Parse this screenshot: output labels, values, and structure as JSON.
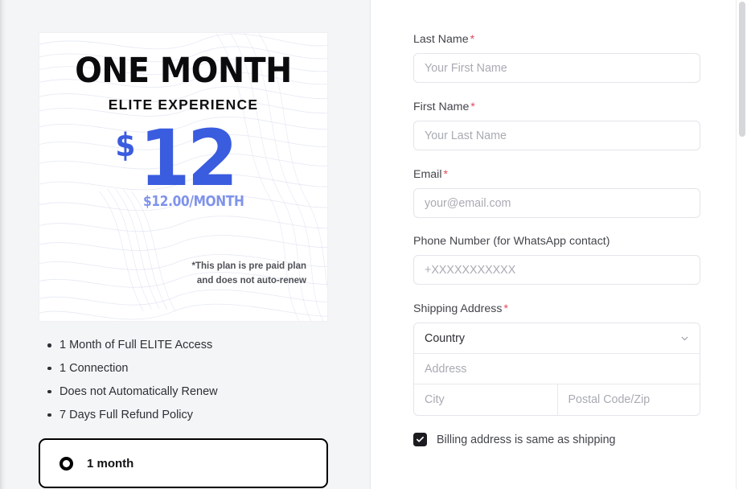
{
  "plan_card": {
    "title": "ONE MONTH",
    "subtitle": "ELITE EXPERIENCE",
    "currency_symbol": "$",
    "price_amount": "12",
    "price_per_month": "$12.00/MONTH",
    "fineprint_line1": "*This plan is pre paid plan",
    "fineprint_line2": "and does not auto-renew",
    "accent_color": "#3a5cdf",
    "accent_light_color": "#7f93ea"
  },
  "features": [
    "1 Month of Full ELITE Access",
    "1 Connection",
    "Does not Automatically Renew",
    "7 Days Full Refund Policy"
  ],
  "plan_option": {
    "label": "1 month",
    "selected": true
  },
  "form": {
    "fields": [
      {
        "label": "Last Name",
        "required": true,
        "placeholder": "Your First Name",
        "value": ""
      },
      {
        "label": "First Name",
        "required": true,
        "placeholder": "Your Last Name",
        "value": ""
      },
      {
        "label": "Email",
        "required": true,
        "placeholder": "your@email.com",
        "value": ""
      },
      {
        "label": "Phone Number (for WhatsApp contact)",
        "required": false,
        "placeholder": "+XXXXXXXXXXX",
        "value": ""
      }
    ],
    "shipping": {
      "label": "Shipping Address",
      "required": true,
      "country_placeholder": "Country",
      "country_value": "",
      "address_placeholder": "Address",
      "address_value": "",
      "city_placeholder": "City",
      "city_value": "",
      "postal_placeholder": "Postal Code/Zip",
      "postal_value": ""
    },
    "billing_checkbox": {
      "label": "Billing address is same as shipping",
      "checked": true
    },
    "required_marker": "*"
  }
}
